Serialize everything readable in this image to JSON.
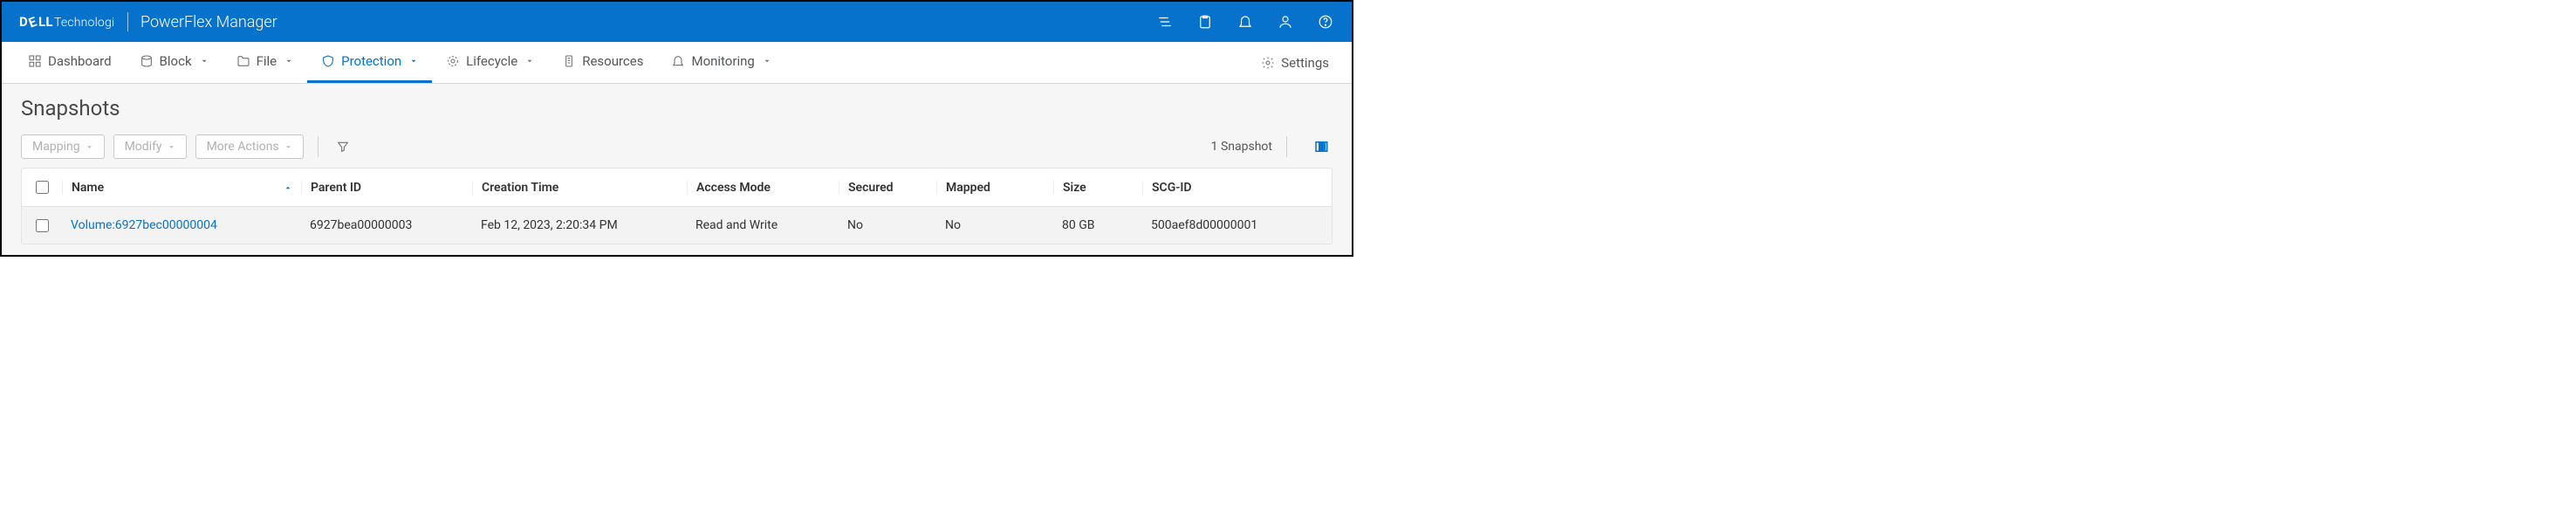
{
  "brand": {
    "logo_strong": "DELL",
    "logo_light": "Technologies",
    "app": "PowerFlex Manager"
  },
  "nav": {
    "dashboard": "Dashboard",
    "block": "Block",
    "file": "File",
    "protection": "Protection",
    "lifecycle": "Lifecycle",
    "resources": "Resources",
    "monitoring": "Monitoring",
    "settings": "Settings"
  },
  "page": {
    "title": "Snapshots"
  },
  "toolbar": {
    "mapping": "Mapping",
    "modify": "Modify",
    "more": "More Actions",
    "count": "1 Snapshot"
  },
  "columns": {
    "name": "Name",
    "parent": "Parent ID",
    "ctime": "Creation Time",
    "access": "Access Mode",
    "secured": "Secured",
    "mapped": "Mapped",
    "size": "Size",
    "scg": "SCG-ID"
  },
  "rows": [
    {
      "name": "Volume:6927bec00000004",
      "parent": "6927bea00000003",
      "ctime": "Feb 12, 2023, 2:20:34 PM",
      "access": "Read and Write",
      "secured": "No",
      "mapped": "No",
      "size": "80 GB",
      "scg": "500aef8d00000001"
    }
  ]
}
